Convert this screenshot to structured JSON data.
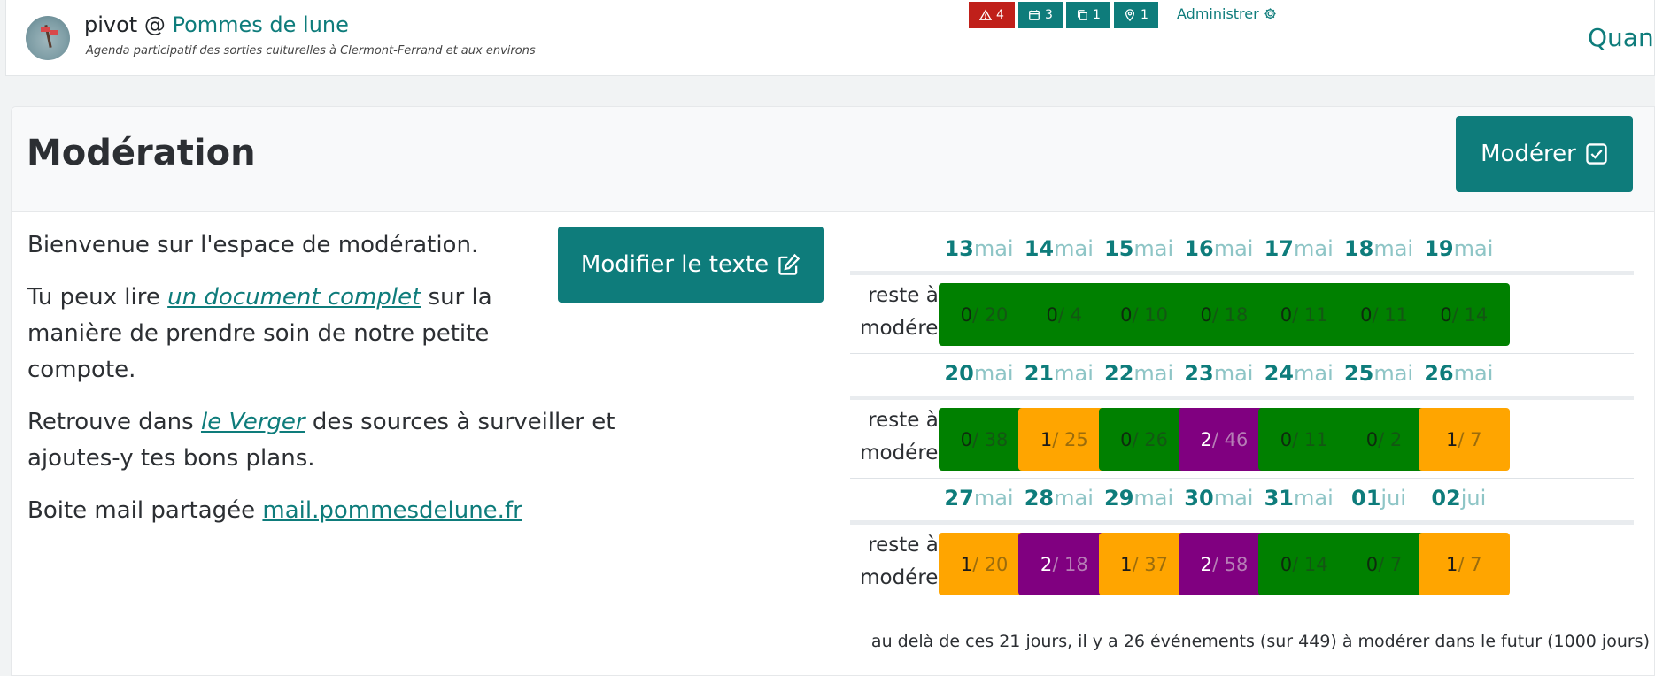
{
  "header": {
    "user": "pivot @ ",
    "brand": "Pommes de lune",
    "subtitle": "Agenda participatif des sorties culturelles à Clermont-Ferrand et aux environs",
    "counters": [
      {
        "name": "alerts",
        "icon": "warning-triangle-icon",
        "value": "4",
        "color": "#c0201a"
      },
      {
        "name": "events",
        "icon": "calendar-icon",
        "value": "3",
        "color": "#0e7c7b"
      },
      {
        "name": "duplicates",
        "icon": "copy-icon",
        "value": "1",
        "color": "#0e7c7b"
      },
      {
        "name": "places",
        "icon": "map-pin-icon",
        "value": "1",
        "color": "#0e7c7b"
      }
    ],
    "admin_label": "Administrer",
    "nav_partial": "Quand"
  },
  "page": {
    "title": "Modération",
    "moderate_button": "Modérer",
    "edit_text_button": "Modifier le texte"
  },
  "intro": {
    "p1": "Bienvenue sur l'espace de modération.",
    "p2_before": "Tu peux lire ",
    "p2_link": "un document complet",
    "p2_after": " sur la manière de prendre soin de notre petite compote.",
    "p3_before": "Retrouve dans ",
    "p3_link": "le Verger",
    "p3_after": " des sources à surveiller et ajoutes-y tes bons plans.",
    "p4_before": "Boite mail partagée ",
    "p4_link": "mail.pommesdelune.fr"
  },
  "calendar": {
    "row_label_line1": "reste à",
    "row_label_line2": "modérer",
    "colors": {
      "green": "#008000",
      "orange": "#ffa500",
      "purple": "#800080"
    },
    "weeks": [
      [
        {
          "day": "13",
          "month": "mai",
          "remaining": "0",
          "total": "/ 20",
          "status": "green"
        },
        {
          "day": "14",
          "month": "mai",
          "remaining": "0",
          "total": "/ 4",
          "status": "green"
        },
        {
          "day": "15",
          "month": "mai",
          "remaining": "0",
          "total": "/ 10",
          "status": "green"
        },
        {
          "day": "16",
          "month": "mai",
          "remaining": "0",
          "total": "/ 18",
          "status": "green"
        },
        {
          "day": "17",
          "month": "mai",
          "remaining": "0",
          "total": "/ 11",
          "status": "green"
        },
        {
          "day": "18",
          "month": "mai",
          "remaining": "0",
          "total": "/ 11",
          "status": "green"
        },
        {
          "day": "19",
          "month": "mai",
          "remaining": "0",
          "total": "/ 14",
          "status": "green"
        }
      ],
      [
        {
          "day": "20",
          "month": "mai",
          "remaining": "0",
          "total": "/ 38",
          "status": "green"
        },
        {
          "day": "21",
          "month": "mai",
          "remaining": "1",
          "total": "/ 25",
          "status": "orange"
        },
        {
          "day": "22",
          "month": "mai",
          "remaining": "0",
          "total": "/ 26",
          "status": "green"
        },
        {
          "day": "23",
          "month": "mai",
          "remaining": "2",
          "total": "/ 46",
          "status": "purple"
        },
        {
          "day": "24",
          "month": "mai",
          "remaining": "0",
          "total": "/ 11",
          "status": "green"
        },
        {
          "day": "25",
          "month": "mai",
          "remaining": "0",
          "total": "/ 2",
          "status": "green"
        },
        {
          "day": "26",
          "month": "mai",
          "remaining": "1",
          "total": "/ 7",
          "status": "orange"
        }
      ],
      [
        {
          "day": "27",
          "month": "mai",
          "remaining": "1",
          "total": "/ 20",
          "status": "orange"
        },
        {
          "day": "28",
          "month": "mai",
          "remaining": "2",
          "total": "/ 18",
          "status": "purple"
        },
        {
          "day": "29",
          "month": "mai",
          "remaining": "1",
          "total": "/ 37",
          "status": "orange"
        },
        {
          "day": "30",
          "month": "mai",
          "remaining": "2",
          "total": "/ 58",
          "status": "purple"
        },
        {
          "day": "31",
          "month": "mai",
          "remaining": "0",
          "total": "/ 14",
          "status": "green"
        },
        {
          "day": "01",
          "month": "jui",
          "remaining": "0",
          "total": "/ 7",
          "status": "green"
        },
        {
          "day": "02",
          "month": "jui",
          "remaining": "1",
          "total": "/ 7",
          "status": "orange"
        }
      ]
    ],
    "footnote": "au delà de ces 21 jours, il y a 26 événements (sur 449) à modérer dans le futur (1000 jours)"
  }
}
